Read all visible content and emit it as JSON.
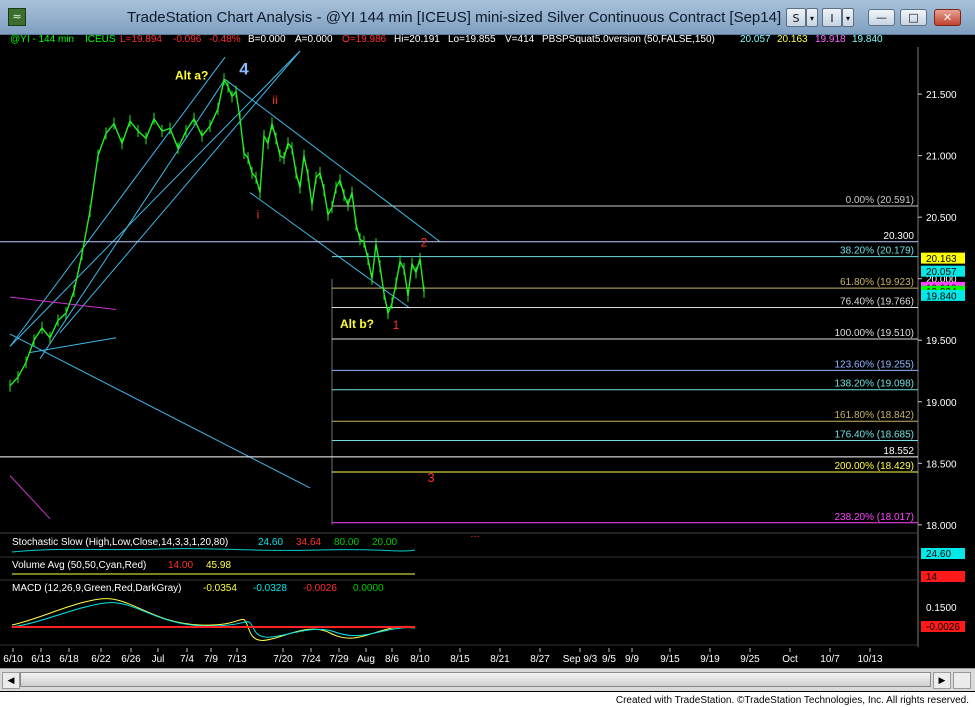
{
  "window": {
    "title": "TradeStation Chart Analysis - @YI 144 min [ICEUS] mini-sized Silver Continuous Contract [Sep14]",
    "app_icon_glyph": "≈",
    "buttons": {
      "s_label": "S",
      "s_arrow": "▾",
      "i_label": "I",
      "i_arrow": "▾",
      "minimize": "—",
      "maximize": "□",
      "close": "✕"
    }
  },
  "info_bar": [
    {
      "text": "@YI - 144 min",
      "color": "#00ff00"
    },
    {
      "text": "ICEUS",
      "color": "#00ff00"
    },
    {
      "text": "L=19.894",
      "color": "#ff3030"
    },
    {
      "text": "-0.096",
      "color": "#ff3030"
    },
    {
      "text": "-0.48%",
      "color": "#ff3030"
    },
    {
      "text": "B=0.000",
      "color": "#ffffff"
    },
    {
      "text": "A=0.000",
      "color": "#ffffff"
    },
    {
      "text": "O=19.986",
      "color": "#ff3030"
    },
    {
      "text": "Hi=20.191",
      "color": "#ffffff"
    },
    {
      "text": "Lo=19.855",
      "color": "#ffffff"
    },
    {
      "text": "V=414",
      "color": "#ffffff"
    },
    {
      "text": "PBSPSquat5.0version (50,FALSE,150)",
      "color": "#ffffff"
    },
    {
      "text": "20.057",
      "color": "#7fffff"
    },
    {
      "text": "20.163",
      "color": "#ffff44"
    },
    {
      "text": "19.918",
      "color": "#ff66ff"
    },
    {
      "text": "19.840",
      "color": "#7fffff"
    }
  ],
  "chart_data": {
    "type": "line",
    "symbol": "@YI",
    "interval": "144 min",
    "x_tick_labels": [
      "6/10",
      "6/13",
      "6/18",
      "6/22",
      "6/26",
      "Jul",
      "7/4",
      "7/9",
      "7/13",
      "7/20",
      "7/24",
      "7/29",
      "Aug",
      "8/6",
      "8/10",
      "8/15",
      "8/21",
      "8/27",
      "Sep 9/3",
      "9/5",
      "9/9",
      "9/15",
      "9/19",
      "9/25",
      "Oct",
      "10/7",
      "10/13"
    ],
    "y_ticks": [
      "21.500",
      "21.000",
      "20.500",
      "20.000",
      "19.500",
      "19.000",
      "18.500",
      "18.000"
    ],
    "ylim": [
      17.95,
      21.85
    ],
    "price_series": {
      "name": "@YI",
      "color": "#22ee22",
      "x": [
        0,
        8,
        16,
        24,
        32,
        40,
        48,
        56,
        64,
        72,
        80,
        88,
        96,
        104,
        112,
        120,
        128,
        136,
        144,
        152,
        160,
        168,
        176,
        184,
        192,
        200,
        208,
        214,
        218,
        222,
        226,
        230,
        234,
        238,
        242,
        246,
        250,
        254,
        258,
        262,
        266,
        270,
        274,
        278,
        282,
        286,
        290,
        294,
        298,
        302,
        306,
        310,
        314,
        318,
        322,
        326,
        330,
        334,
        338,
        342,
        346,
        350,
        354,
        358,
        362,
        366,
        370,
        374,
        378,
        382,
        386,
        390,
        394,
        398,
        402,
        406,
        410,
        414
      ],
      "close": [
        19.13,
        19.2,
        19.32,
        19.5,
        19.6,
        19.52,
        19.66,
        19.72,
        19.9,
        20.2,
        20.55,
        21.0,
        21.18,
        21.26,
        21.1,
        21.28,
        21.2,
        21.14,
        21.3,
        21.2,
        21.22,
        21.06,
        21.2,
        21.3,
        21.16,
        21.24,
        21.38,
        21.62,
        21.56,
        21.48,
        21.52,
        21.3,
        21.02,
        20.98,
        20.86,
        20.82,
        20.7,
        21.16,
        21.1,
        21.26,
        21.14,
        21.0,
        20.98,
        21.1,
        21.06,
        20.86,
        20.74,
        21.0,
        20.84,
        20.6,
        20.82,
        20.86,
        20.72,
        20.52,
        20.58,
        20.74,
        20.8,
        20.68,
        20.6,
        20.7,
        20.44,
        20.32,
        20.3,
        20.16,
        20.0,
        20.28,
        20.1,
        19.88,
        19.72,
        19.8,
        19.96,
        20.14,
        20.08,
        19.86,
        20.12,
        20.05,
        20.16,
        19.894
      ],
      "alt_a_high": 21.64,
      "low_1": 19.84
    },
    "fibonacci_levels": [
      {
        "label": "0.00% (20.591)",
        "value": 20.591,
        "color": "#c8c8c8"
      },
      {
        "label": "38.20% (20.179)",
        "value": 20.179,
        "color": "#6fe0e0"
      },
      {
        "label": "61.80% (19.923)",
        "value": 19.923,
        "color": "#c8b466"
      },
      {
        "label": "76.40% (19.766)",
        "value": 19.766,
        "color": "#dddddd"
      },
      {
        "label": "100.00% (19.510)",
        "value": 19.51,
        "color": "#dddddd"
      },
      {
        "label": "123.60% (19.255)",
        "value": 19.255,
        "color": "#8fb8ff"
      },
      {
        "label": "138.20% (19.098)",
        "value": 19.098,
        "color": "#6fe0e0"
      },
      {
        "label": "161.80% (18.842)",
        "value": 18.842,
        "color": "#c8b466"
      },
      {
        "label": "176.40% (18.685)",
        "value": 18.685,
        "color": "#6fe0e0"
      },
      {
        "label": "200.00% (18.429)",
        "value": 18.429,
        "color": "#ffff44"
      },
      {
        "label": "238.20% (18.017)",
        "value": 18.017,
        "color": "#ff44ff"
      }
    ],
    "horizontal_lines": [
      {
        "label": "20.300",
        "value": 20.3,
        "color": "#bbccff"
      },
      {
        "label": "18.552",
        "value": 18.552,
        "color": "#ffffff"
      }
    ],
    "price_axis_markers": [
      {
        "label": "20.163",
        "value": 20.163,
        "bg": "#ffff00",
        "fg": "#000000"
      },
      {
        "label": "20.057",
        "value": 20.057,
        "bg": "#00e8e8",
        "fg": "#000000"
      },
      {
        "label": "19.918",
        "value": 19.925,
        "bg": "#ff44ff",
        "fg": "#000000"
      },
      {
        "label": "19.894",
        "value": 19.894,
        "bg": "#00ff00",
        "fg": "#000000"
      },
      {
        "label": "19.840",
        "value": 19.86,
        "bg": "#00e8e8",
        "fg": "#000000"
      }
    ],
    "wave_labels": [
      {
        "text": "4",
        "color": "#8fb8ff"
      },
      {
        "text": "Alt a?",
        "color": "#ffff33"
      },
      {
        "text": "ii",
        "color": "#ff3030"
      },
      {
        "text": "i",
        "color": "#ff3030"
      },
      {
        "text": "2",
        "color": "#ff3030"
      },
      {
        "text": "Alt b?",
        "color": "#ffff33"
      },
      {
        "text": "1",
        "color": "#ff3030"
      },
      {
        "text": "3",
        "color": "#ff3030"
      },
      {
        "text": "...",
        "color": "#ff3030"
      }
    ]
  },
  "indicators": {
    "stochastic": {
      "label": "Stochastic Slow (High,Low,Close,14,3,3,1,20,80)",
      "values": [
        {
          "text": "24.60",
          "color": "#00e8e8"
        },
        {
          "text": "34.64",
          "color": "#ff3030"
        },
        {
          "text": "80.00",
          "color": "#00cc00"
        },
        {
          "text": "20.00",
          "color": "#00cc00"
        }
      ],
      "axis_value": "24.60"
    },
    "volume_avg": {
      "label": "Volume Avg (50,50,Cyan,Red)",
      "values": [
        {
          "text": "14.00",
          "color": "#ff3030"
        },
        {
          "text": "45.98",
          "color": "#ffff44"
        }
      ],
      "axis_value": "14"
    },
    "macd": {
      "label": "MACD (12,26,9,Green,Red,DarkGray)",
      "values": [
        {
          "text": "-0.0354",
          "color": "#ffff44"
        },
        {
          "text": "-0.0328",
          "color": "#00e8e8"
        },
        {
          "text": "-0.0026",
          "color": "#ff3030"
        },
        {
          "text": "0.0000",
          "color": "#00cc00"
        }
      ],
      "axis_tick": "0.1500",
      "axis_value": "-0.0026"
    }
  },
  "scrollbar": {
    "left_arrow": "◀",
    "right_arrow": "▶"
  },
  "footer": {
    "credit": "Created with TradeStation. ©TradeStation Technologies, Inc. All rights reserved."
  }
}
